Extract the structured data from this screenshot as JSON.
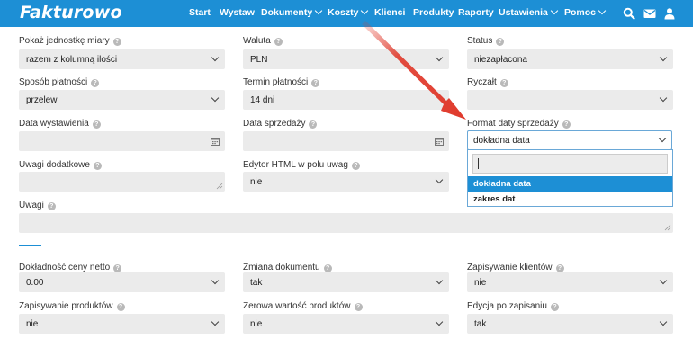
{
  "app": {
    "logo": "Fakturowo"
  },
  "nav": {
    "start": "Start",
    "wystaw": "Wystaw",
    "dokumenty": "Dokumenty",
    "koszty": "Koszty",
    "klienci": "Klienci",
    "produkty": "Produkty",
    "raporty": "Raporty",
    "ustawienia": "Ustawienia",
    "pomoc": "Pomoc"
  },
  "icons": {
    "search": "search-icon",
    "mail": "mail-icon",
    "user": "user-icon",
    "help": "help-icon",
    "calendar": "calendar-icon",
    "caret": "chevron-down-icon"
  },
  "colors": {
    "brand": "#1d8fd5",
    "field_bg": "#ebebeb",
    "arrow": "#e03a2c"
  },
  "help_glyph": "?",
  "form": {
    "units": {
      "label": "Pokaż jednostkę miary",
      "value": "razem z kolumną ilości"
    },
    "currency": {
      "label": "Waluta",
      "value": "PLN"
    },
    "status": {
      "label": "Status",
      "value": "niezapłacona"
    },
    "payment_method": {
      "label": "Sposób płatności",
      "value": "przelew"
    },
    "payment_term": {
      "label": "Termin płatności",
      "value": "14 dni"
    },
    "flat_rate": {
      "label": "Ryczałt",
      "value": ""
    },
    "issue_date": {
      "label": "Data wystawienia",
      "value": ""
    },
    "sale_date": {
      "label": "Data sprzedaży",
      "value": ""
    },
    "sale_date_format": {
      "label": "Format daty sprzedaży",
      "value": "dokładna data",
      "search_value": "",
      "options": [
        "dokładna data",
        "zakres dat"
      ],
      "highlighted": "dokładna data"
    },
    "extra_notes": {
      "label": "Uwagi dodatkowe",
      "value": ""
    },
    "html_editor": {
      "label": "Edytor HTML w polu uwag",
      "value": "nie"
    },
    "notes": {
      "label": "Uwagi",
      "value": ""
    },
    "net_precision": {
      "label": "Dokładność ceny netto",
      "value": "0.00"
    },
    "doc_change": {
      "label": "Zmiana dokumentu",
      "value": "tak"
    },
    "save_clients": {
      "label": "Zapisywanie klientów",
      "value": "nie"
    },
    "save_products": {
      "label": "Zapisywanie produktów",
      "value": "nie"
    },
    "zero_product_value": {
      "label": "Zerowa wartość produktów",
      "value": "nie"
    },
    "edit_after_save": {
      "label": "Edycja po zapisaniu",
      "value": "tak"
    }
  }
}
